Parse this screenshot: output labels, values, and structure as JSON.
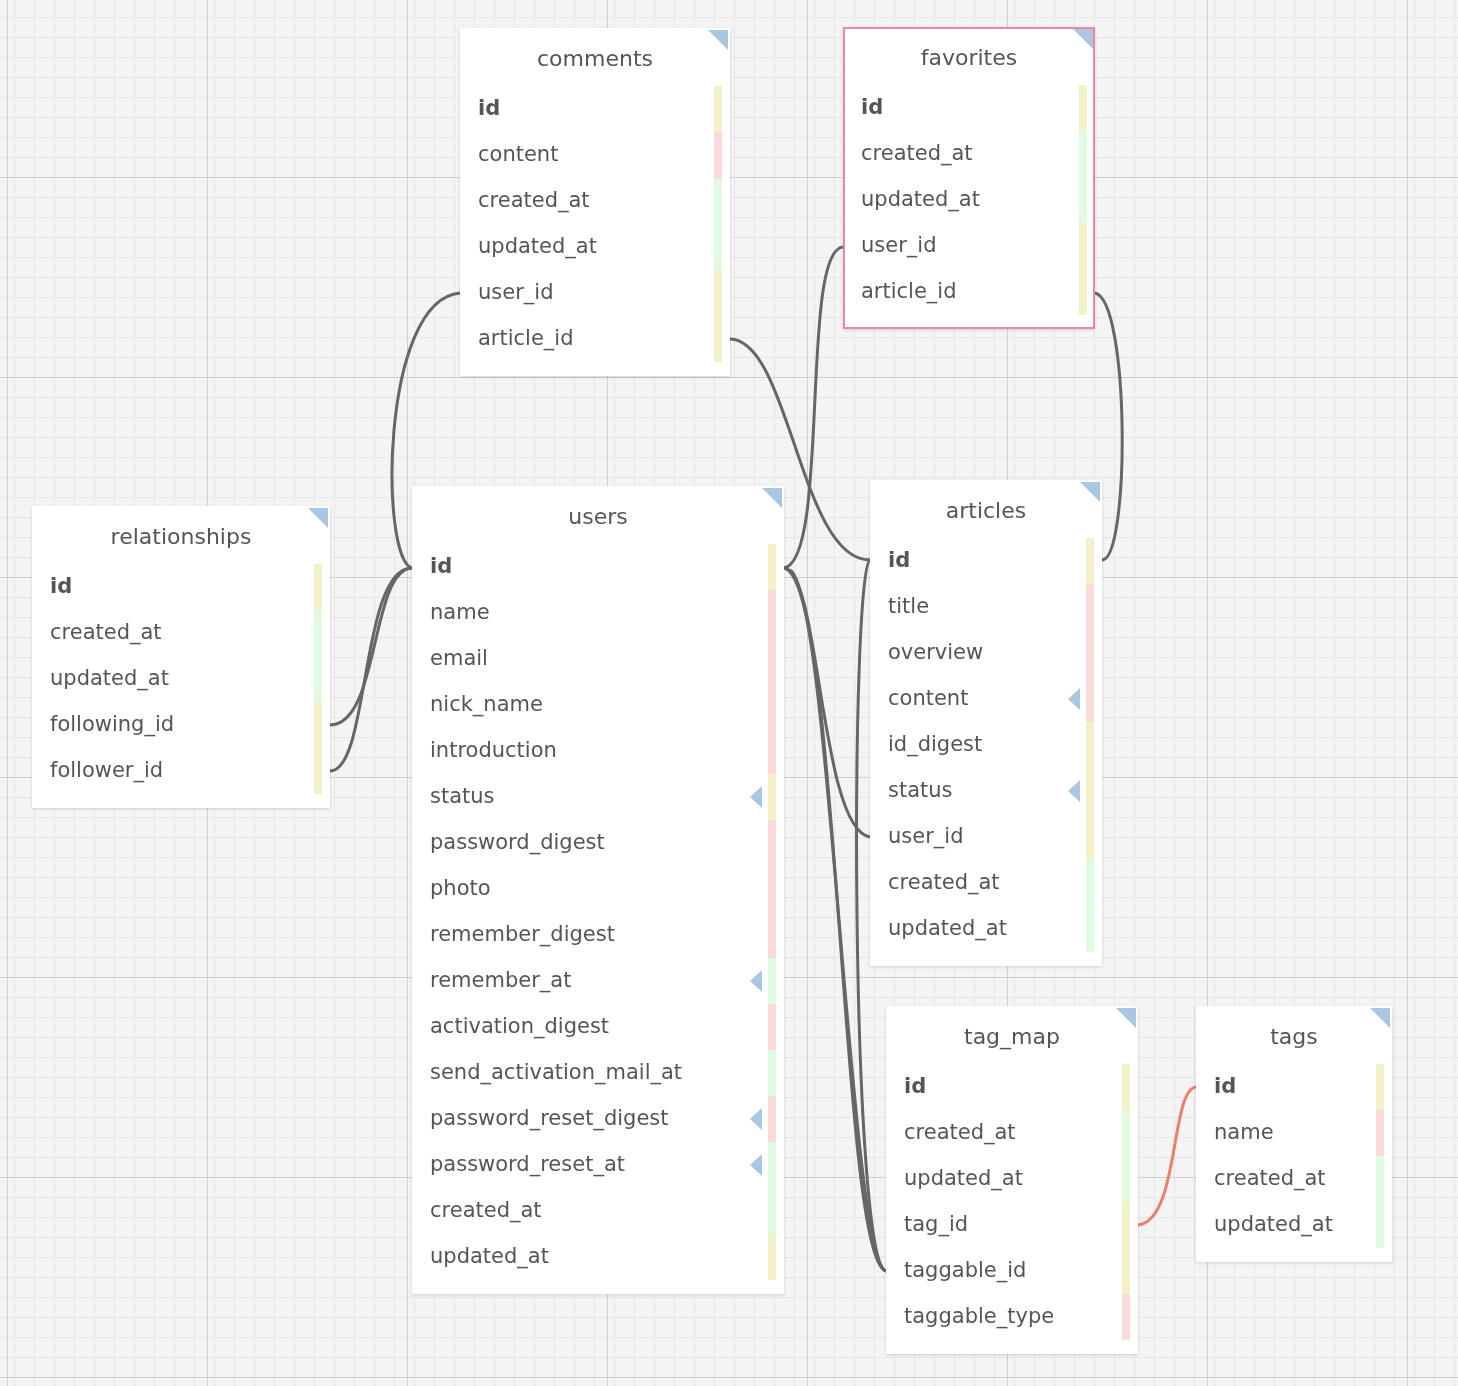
{
  "tables": [
    {
      "name": "comments",
      "selected": false,
      "fields": [
        {
          "name": "id",
          "primary": true,
          "indexed": false,
          "color": "#f3f1c6"
        },
        {
          "name": "content",
          "primary": false,
          "indexed": false,
          "color": "#f9d9d9"
        },
        {
          "name": "created_at",
          "primary": false,
          "indexed": false,
          "color": "#e0fbdf"
        },
        {
          "name": "updated_at",
          "primary": false,
          "indexed": false,
          "color": "#e0fbdf"
        },
        {
          "name": "user_id",
          "primary": false,
          "indexed": false,
          "color": "#f3f1c6"
        },
        {
          "name": "article_id",
          "primary": false,
          "indexed": false,
          "color": "#f3f1c6"
        }
      ]
    },
    {
      "name": "favorites",
      "selected": true,
      "fields": [
        {
          "name": "id",
          "primary": true,
          "indexed": false,
          "color": "#f3f1c6"
        },
        {
          "name": "created_at",
          "primary": false,
          "indexed": false,
          "color": "#e0fbdf"
        },
        {
          "name": "updated_at",
          "primary": false,
          "indexed": false,
          "color": "#e0fbdf"
        },
        {
          "name": "user_id",
          "primary": false,
          "indexed": false,
          "color": "#f3f1c6"
        },
        {
          "name": "article_id",
          "primary": false,
          "indexed": false,
          "color": "#f3f1c6"
        }
      ]
    },
    {
      "name": "relationships",
      "selected": false,
      "fields": [
        {
          "name": "id",
          "primary": true,
          "indexed": false,
          "color": "#f3f1c6"
        },
        {
          "name": "created_at",
          "primary": false,
          "indexed": false,
          "color": "#e0fbdf"
        },
        {
          "name": "updated_at",
          "primary": false,
          "indexed": false,
          "color": "#e0fbdf"
        },
        {
          "name": "following_id",
          "primary": false,
          "indexed": false,
          "color": "#f3f1c6"
        },
        {
          "name": "follower_id",
          "primary": false,
          "indexed": false,
          "color": "#f3f1c6"
        }
      ]
    },
    {
      "name": "users",
      "selected": false,
      "fields": [
        {
          "name": "id",
          "primary": true,
          "indexed": false,
          "color": "#f3f1c6"
        },
        {
          "name": "name",
          "primary": false,
          "indexed": false,
          "color": "#f9d9d9"
        },
        {
          "name": "email",
          "primary": false,
          "indexed": false,
          "color": "#f9d9d9"
        },
        {
          "name": "nick_name",
          "primary": false,
          "indexed": false,
          "color": "#f9d9d9"
        },
        {
          "name": "introduction",
          "primary": false,
          "indexed": false,
          "color": "#f9d9d9"
        },
        {
          "name": "status",
          "primary": false,
          "indexed": true,
          "color": "#f3f1c6"
        },
        {
          "name": "password_digest",
          "primary": false,
          "indexed": false,
          "color": "#f9d9d9"
        },
        {
          "name": "photo",
          "primary": false,
          "indexed": false,
          "color": "#f9d9d9"
        },
        {
          "name": "remember_digest",
          "primary": false,
          "indexed": false,
          "color": "#f9d9d9"
        },
        {
          "name": "remember_at",
          "primary": false,
          "indexed": true,
          "color": "#e0fbdf"
        },
        {
          "name": "activation_digest",
          "primary": false,
          "indexed": false,
          "color": "#f9d9d9"
        },
        {
          "name": "send_activation_mail_at",
          "primary": false,
          "indexed": false,
          "color": "#e0fbdf"
        },
        {
          "name": "password_reset_digest",
          "primary": false,
          "indexed": true,
          "color": "#f9d9d9"
        },
        {
          "name": "password_reset_at",
          "primary": false,
          "indexed": true,
          "color": "#e0fbdf"
        },
        {
          "name": "created_at",
          "primary": false,
          "indexed": false,
          "color": "#e0fbdf"
        },
        {
          "name": "updated_at",
          "primary": false,
          "indexed": false,
          "color": "#f3f1c6"
        }
      ]
    },
    {
      "name": "articles",
      "selected": false,
      "fields": [
        {
          "name": "id",
          "primary": true,
          "indexed": false,
          "color": "#f3f1c6"
        },
        {
          "name": "title",
          "primary": false,
          "indexed": false,
          "color": "#f9d9d9"
        },
        {
          "name": "overview",
          "primary": false,
          "indexed": false,
          "color": "#f9d9d9"
        },
        {
          "name": "content",
          "primary": false,
          "indexed": true,
          "color": "#f9d9d9"
        },
        {
          "name": "id_digest",
          "primary": false,
          "indexed": false,
          "color": "#f3f1c6"
        },
        {
          "name": "status",
          "primary": false,
          "indexed": true,
          "color": "#f3f1c6"
        },
        {
          "name": "user_id",
          "primary": false,
          "indexed": false,
          "color": "#f3f1c6"
        },
        {
          "name": "created_at",
          "primary": false,
          "indexed": false,
          "color": "#e0fbdf"
        },
        {
          "name": "updated_at",
          "primary": false,
          "indexed": false,
          "color": "#e0fbdf"
        }
      ]
    },
    {
      "name": "tag_map",
      "selected": false,
      "fields": [
        {
          "name": "id",
          "primary": true,
          "indexed": false,
          "color": "#f3f1c6"
        },
        {
          "name": "created_at",
          "primary": false,
          "indexed": false,
          "color": "#e0fbdf"
        },
        {
          "name": "updated_at",
          "primary": false,
          "indexed": false,
          "color": "#e0fbdf"
        },
        {
          "name": "tag_id",
          "primary": false,
          "indexed": false,
          "color": "#f3f1c6"
        },
        {
          "name": "taggable_id",
          "primary": false,
          "indexed": false,
          "color": "#f3f1c6"
        },
        {
          "name": "taggable_type",
          "primary": false,
          "indexed": false,
          "color": "#f9d9d9"
        }
      ]
    },
    {
      "name": "tags",
      "selected": false,
      "fields": [
        {
          "name": "id",
          "primary": true,
          "indexed": false,
          "color": "#f3f1c6"
        },
        {
          "name": "name",
          "primary": false,
          "indexed": false,
          "color": "#f9d9d9"
        },
        {
          "name": "created_at",
          "primary": false,
          "indexed": false,
          "color": "#e0fbdf"
        },
        {
          "name": "updated_at",
          "primary": false,
          "indexed": false,
          "color": "#e0fbdf"
        }
      ]
    }
  ]
}
